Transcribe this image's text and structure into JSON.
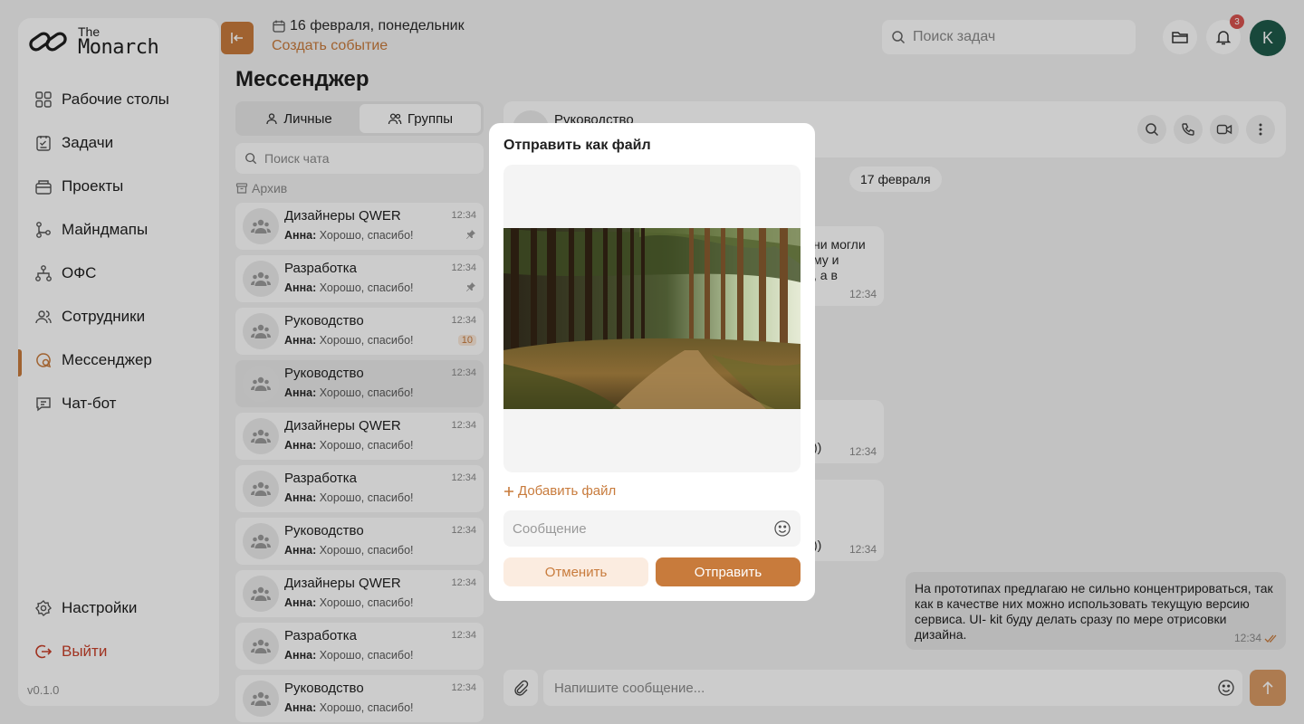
{
  "colors": {
    "accent": "#c87b3c",
    "danger": "#c8402a",
    "badge": "#d9534f"
  },
  "logo": {
    "the": "The",
    "name": "Monarch"
  },
  "sidebar": {
    "items": [
      {
        "label": "Рабочие столы",
        "icon": "grid-icon"
      },
      {
        "label": "Задачи",
        "icon": "tasks-icon"
      },
      {
        "label": "Проекты",
        "icon": "projects-icon"
      },
      {
        "label": "Майндмапы",
        "icon": "mindmap-icon"
      },
      {
        "label": "ОФС",
        "icon": "org-icon"
      },
      {
        "label": "Сотрудники",
        "icon": "users-icon"
      },
      {
        "label": "Мессенджер",
        "icon": "messenger-icon",
        "active": true
      },
      {
        "label": "Чат-бот",
        "icon": "chatbot-icon"
      }
    ],
    "settings": "Настройки",
    "logout": "Выйти",
    "version": "v0.1.0"
  },
  "header": {
    "date": "16 февраля, понедельник",
    "create_event": "Создать событие",
    "search_placeholder": "Поиск задач",
    "notifications_count": "3",
    "avatar_letter": "K"
  },
  "page_title": "Мессенджер",
  "chat_list": {
    "tabs": {
      "personal": "Личные",
      "groups": "Группы"
    },
    "search_placeholder": "Поиск чата",
    "archive": "Архив",
    "items": [
      {
        "name": "Дизайнеры QWER",
        "time": "12:34",
        "author": "Анна:",
        "message": "Хорошо, спасибо!",
        "pinned": true
      },
      {
        "name": "Разработка",
        "time": "12:34",
        "author": "Анна:",
        "message": "Хорошо, спасибо!",
        "pinned": true
      },
      {
        "name": "Руководство",
        "time": "12:34",
        "author": "Анна:",
        "message": "Хорошо, спасибо!",
        "unread": "10"
      },
      {
        "name": "Руководство",
        "time": "12:34",
        "author": "Анна:",
        "message": "Хорошо, спасибо!",
        "selected": true
      },
      {
        "name": "Дизайнеры QWER",
        "time": "12:34",
        "author": "Анна:",
        "message": "Хорошо, спасибо!"
      },
      {
        "name": "Разработка",
        "time": "12:34",
        "author": "Анна:",
        "message": "Хорошо, спасибо!"
      },
      {
        "name": "Руководство",
        "time": "12:34",
        "author": "Анна:",
        "message": "Хорошо, спасибо!"
      },
      {
        "name": "Дизайнеры QWER",
        "time": "12:34",
        "author": "Анна:",
        "message": "Хорошо, спасибо!"
      },
      {
        "name": "Разработка",
        "time": "12:34",
        "author": "Анна:",
        "message": "Хорошо, спасибо!"
      },
      {
        "name": "Руководство",
        "time": "12:34",
        "author": "Анна:",
        "message": "Хорошо, спасибо!"
      }
    ]
  },
  "chat": {
    "title": "Руководство",
    "date_separator": "17 февраля",
    "bubble1_lines": [
      "ни могли",
      "му и",
      ", а в"
    ],
    "bubble1_time": "12:34",
    "bubble2_tail": "))",
    "bubble2_time": "12:34",
    "bubble3_tail": "))",
    "bubble3_time": "12:34",
    "outgoing_text": "На прототипах предлагаю не сильно концентрироваться, так как в качестве них можно использовать текущую версию сервиса. UI- kit буду делать сразу по мере отрисовки дизайна.",
    "outgoing_time": "12:34",
    "composer_placeholder": "Напишите сообщение..."
  },
  "modal": {
    "title": "Отправить как файл",
    "add_file": "Добавить файл",
    "message_placeholder": "Сообщение",
    "cancel": "Отменить",
    "send": "Отправить"
  }
}
